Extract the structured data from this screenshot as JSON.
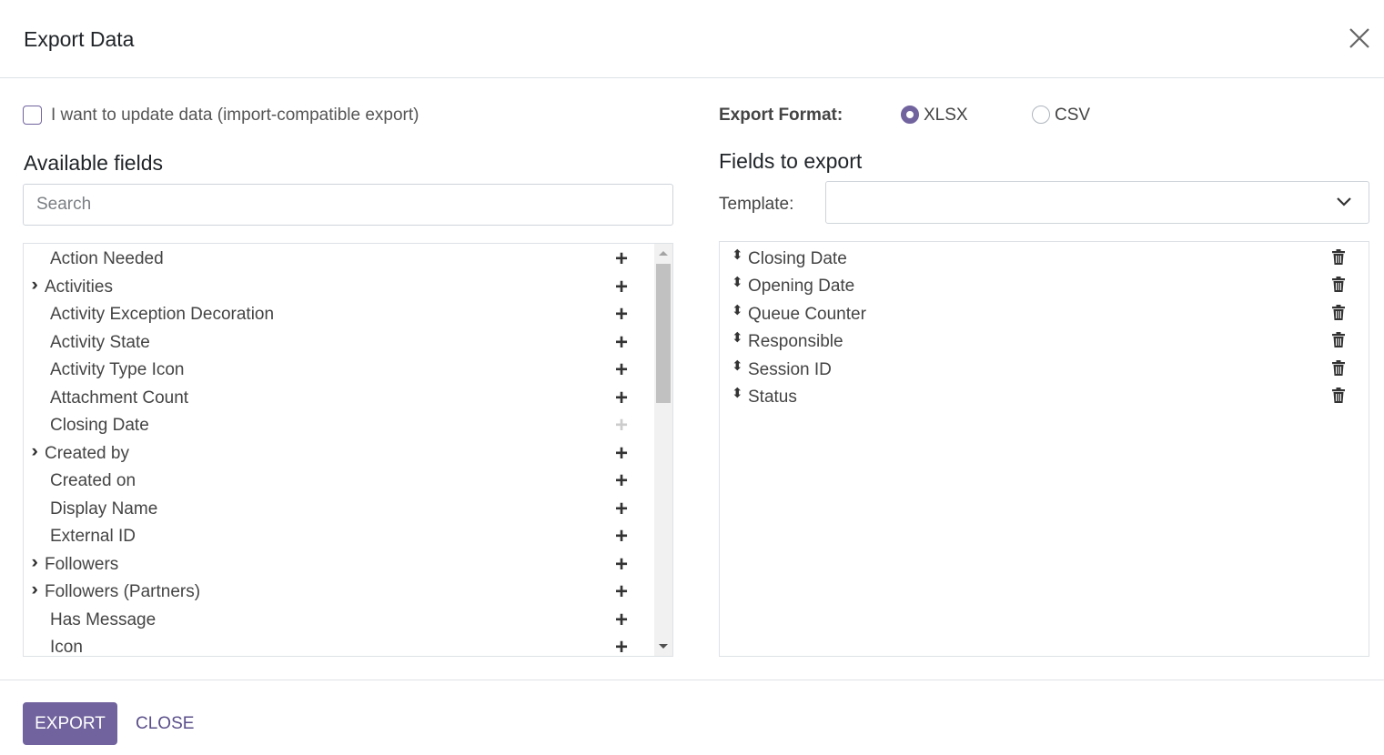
{
  "dialog": {
    "title": "Export Data"
  },
  "options": {
    "import_compatible_label": "I want to update data (import-compatible export)",
    "import_compatible_checked": false
  },
  "available": {
    "heading": "Available fields",
    "search_placeholder": "Search",
    "items": [
      {
        "label": "Action Needed",
        "expandable": false,
        "disabled": false
      },
      {
        "label": "Activities",
        "expandable": true,
        "disabled": false
      },
      {
        "label": "Activity Exception Decoration",
        "expandable": false,
        "disabled": false
      },
      {
        "label": "Activity State",
        "expandable": false,
        "disabled": false
      },
      {
        "label": "Activity Type Icon",
        "expandable": false,
        "disabled": false
      },
      {
        "label": "Attachment Count",
        "expandable": false,
        "disabled": false
      },
      {
        "label": "Closing Date",
        "expandable": false,
        "disabled": true
      },
      {
        "label": "Created by",
        "expandable": true,
        "disabled": false
      },
      {
        "label": "Created on",
        "expandable": false,
        "disabled": false
      },
      {
        "label": "Display Name",
        "expandable": false,
        "disabled": false
      },
      {
        "label": "External ID",
        "expandable": false,
        "disabled": false
      },
      {
        "label": "Followers",
        "expandable": true,
        "disabled": false
      },
      {
        "label": "Followers (Partners)",
        "expandable": true,
        "disabled": false
      },
      {
        "label": "Has Message",
        "expandable": false,
        "disabled": false
      },
      {
        "label": "Icon",
        "expandable": false,
        "disabled": false
      }
    ]
  },
  "format": {
    "label": "Export Format:",
    "options": [
      "XLSX",
      "CSV"
    ],
    "selected": "XLSX"
  },
  "export_fields": {
    "heading": "Fields to export",
    "template_label": "Template:",
    "template_value": "",
    "items": [
      "Closing Date",
      "Opening Date",
      "Queue Counter",
      "Responsible",
      "Session ID",
      "Status"
    ]
  },
  "footer": {
    "export_label": "EXPORT",
    "close_label": "CLOSE"
  },
  "colors": {
    "accent": "#71639e"
  }
}
